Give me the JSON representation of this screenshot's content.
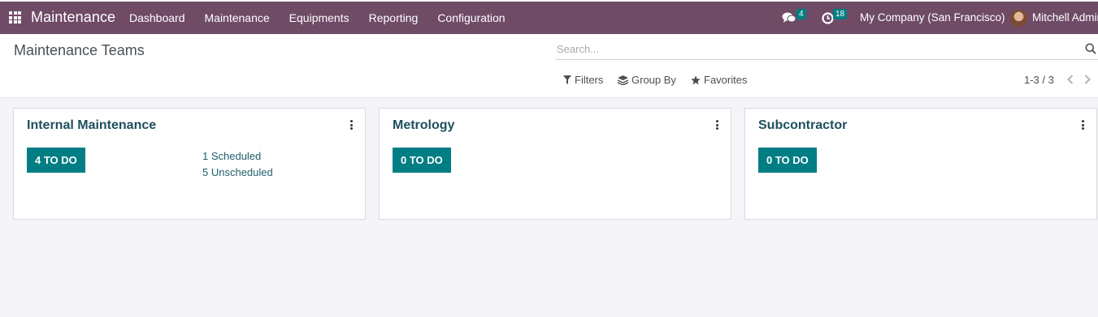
{
  "colors": {
    "navbar": "#6f4b66",
    "accent": "#017e84",
    "background": "#f5f5f9"
  },
  "app": {
    "name": "Maintenance"
  },
  "menu": [
    {
      "label": "Dashboard"
    },
    {
      "label": "Maintenance"
    },
    {
      "label": "Equipments"
    },
    {
      "label": "Reporting"
    },
    {
      "label": "Configuration"
    }
  ],
  "systray": {
    "messages_icon": "chat-icon",
    "messages_count": "4",
    "activities_icon": "clock-icon",
    "activities_count": "18",
    "company": "My Company (San Francisco)",
    "user": "Mitchell Admin"
  },
  "control_panel": {
    "title": "Maintenance Teams",
    "search_placeholder": "Search...",
    "filters_label": "Filters",
    "groupby_label": "Group By",
    "favorites_label": "Favorites",
    "pager": "1-3 / 3"
  },
  "teams": [
    {
      "name": "Internal Maintenance",
      "todo": "4 TO DO",
      "scheduled": "1 Scheduled",
      "unscheduled": "5 Unscheduled"
    },
    {
      "name": "Metrology",
      "todo": "0 TO DO"
    },
    {
      "name": "Subcontractor",
      "todo": "0 TO DO"
    }
  ]
}
